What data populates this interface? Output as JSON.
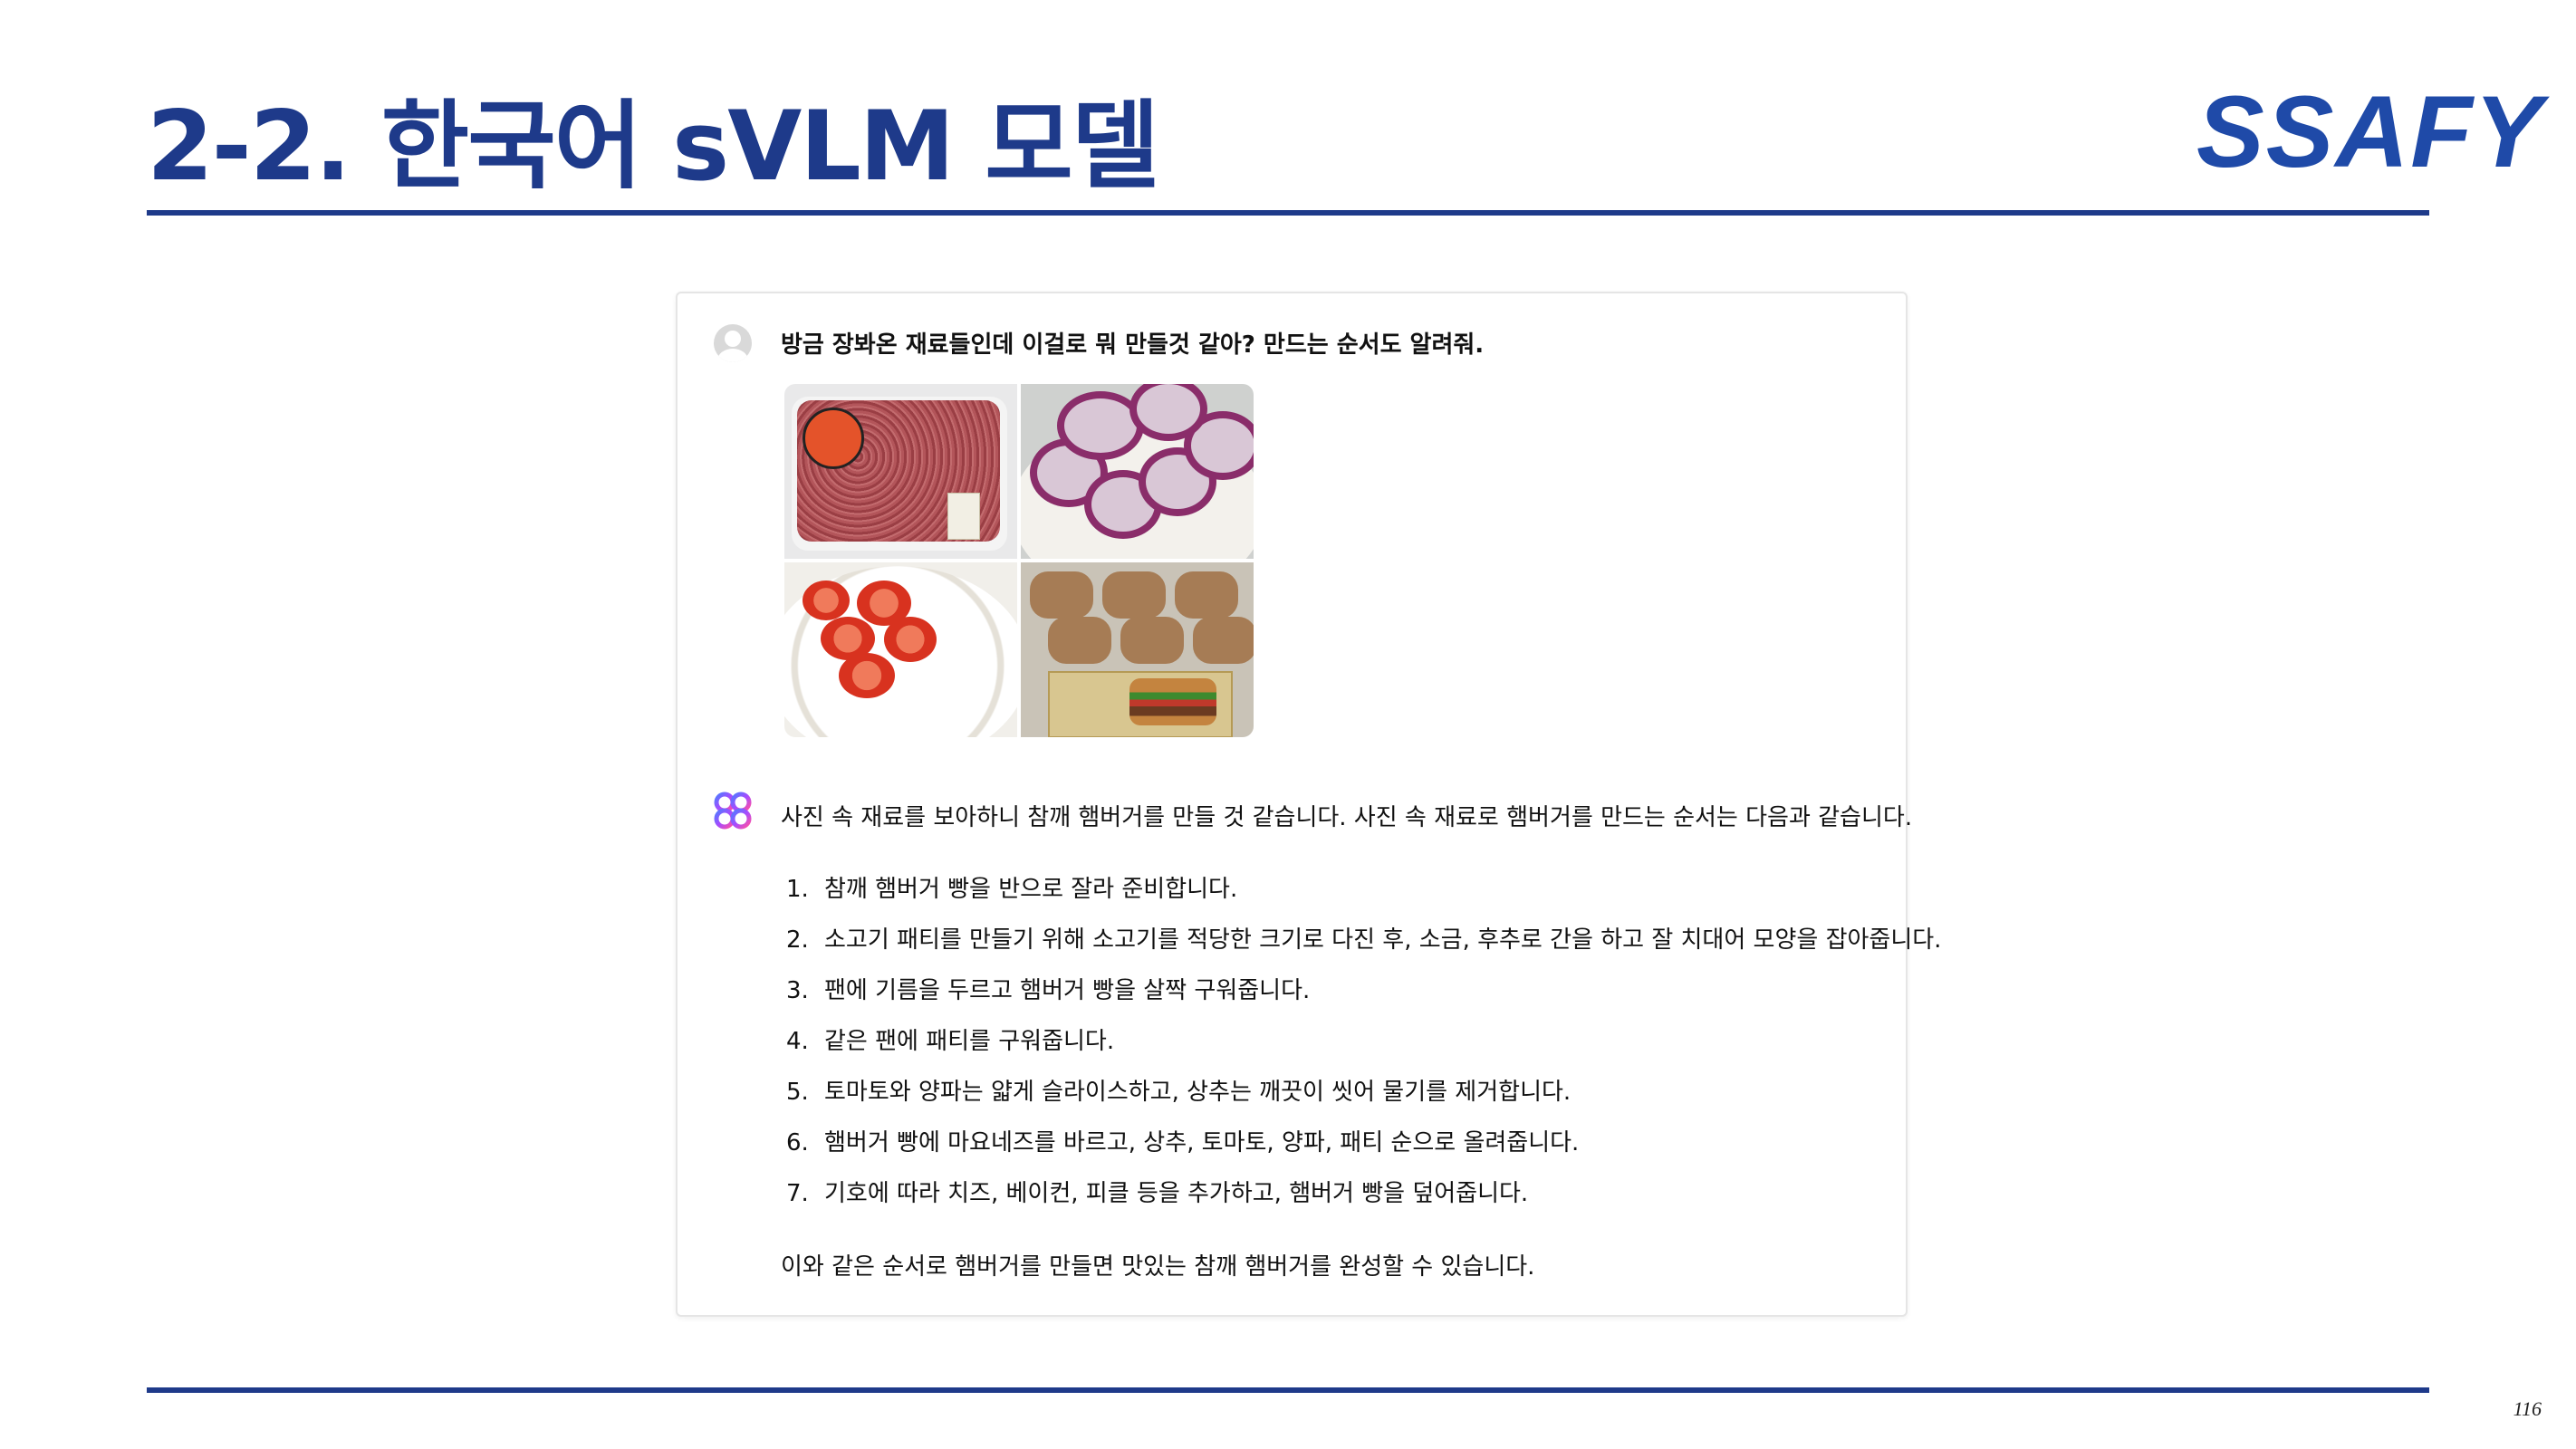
{
  "slide": {
    "title": "2-2. 한국어 sVLM 모델",
    "logo_text": "SSAFY",
    "page_number": "116",
    "accent_color": "#1e3a8a"
  },
  "chat": {
    "user_message": "방금 장봐온 재료들인데 이걸로 뭐 만들것 같아? 만드는 순서도 알려줘.",
    "photos": [
      "ground-beef",
      "sliced-red-onion",
      "sliced-tomato",
      "hamburger-buns"
    ],
    "assistant_intro": "사진 속 재료를 보아하니 참깨 햄버거를 만들 것 같습니다. 사진 속 재료로 햄버거를 만드는 순서는 다음과 같습니다.",
    "steps": [
      {
        "num": "1.",
        "text": "참깨 햄버거 빵을 반으로 잘라 준비합니다."
      },
      {
        "num": "2.",
        "text": "소고기 패티를 만들기 위해 소고기를 적당한 크기로 다진 후, 소금, 후추로 간을 하고 잘 치대어 모양을 잡아줍니다."
      },
      {
        "num": "3.",
        "text": "팬에 기름을 두르고 햄버거 빵을 살짝 구워줍니다."
      },
      {
        "num": "4.",
        "text": "같은 팬에 패티를 구워줍니다."
      },
      {
        "num": "5.",
        "text": "토마토와 양파는 얇게 슬라이스하고, 상추는 깨끗이 씻어 물기를 제거합니다."
      },
      {
        "num": "6.",
        "text": "햄버거 빵에 마요네즈를 바르고, 상추, 토마토, 양파, 패티 순으로 올려줍니다."
      },
      {
        "num": "7.",
        "text": "기호에 따라 치즈, 베이컨, 피클 등을 추가하고, 햄버거 빵을 덮어줍니다."
      }
    ],
    "assistant_closing": "이와 같은 순서로 햄버거를 만들면 맛있는 참깨 햄버거를 완성할 수 있습니다."
  }
}
